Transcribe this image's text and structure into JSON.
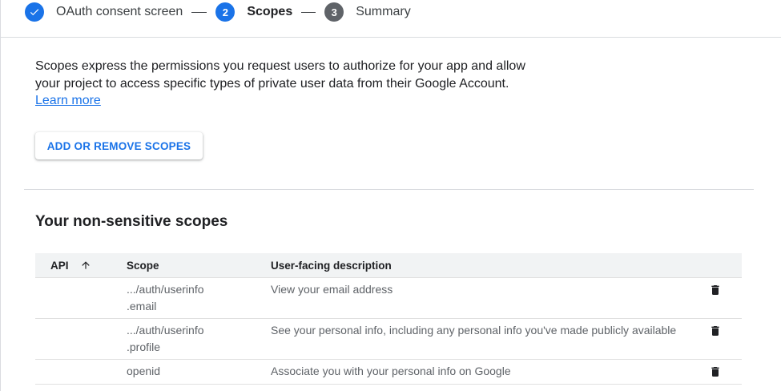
{
  "stepper": {
    "steps": [
      {
        "number": "",
        "label": "OAuth consent screen",
        "state": "done"
      },
      {
        "number": "2",
        "label": "Scopes",
        "state": "active"
      },
      {
        "number": "3",
        "label": "Summary",
        "state": "todo"
      }
    ]
  },
  "intro": {
    "text": "Scopes express the permissions you request users to authorize for your app and allow your project to access specific types of private user data from their Google Account.",
    "link": "Learn more"
  },
  "add_remove_button": "ADD OR REMOVE SCOPES",
  "section_title": "Your non-sensitive scopes",
  "table": {
    "headers": {
      "api": "API",
      "scope": "Scope",
      "description": "User-facing description"
    },
    "rows": [
      {
        "api": "",
        "scope_line1": ".../auth/userinfo",
        "scope_line2": ".email",
        "description": "View your email address"
      },
      {
        "api": "",
        "scope_line1": ".../auth/userinfo",
        "scope_line2": ".profile",
        "description": "See your personal info, including any personal info you've made publicly available"
      },
      {
        "api": "",
        "scope_line1": "openid",
        "scope_line2": "",
        "description": "Associate you with your personal info on Google"
      }
    ]
  },
  "colors": {
    "accent": "#1a73e8",
    "step_inactive": "#5f6368",
    "header_bg": "#f1f3f4"
  },
  "icons": {
    "step_done": "check-icon",
    "sort": "arrow-up-icon",
    "delete": "trash-icon"
  }
}
